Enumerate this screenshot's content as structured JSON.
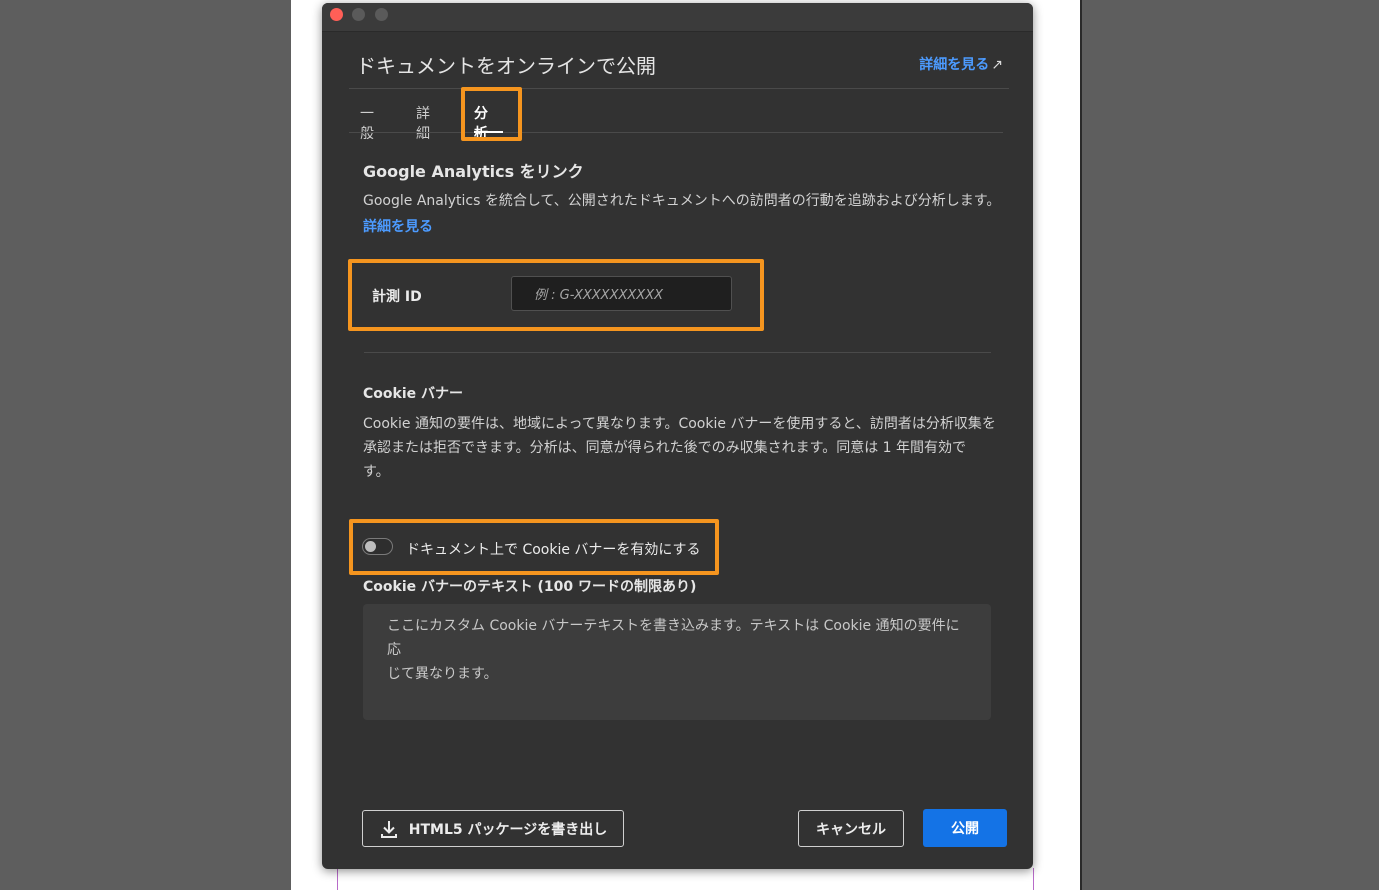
{
  "dialog": {
    "title": "ドキュメントをオンラインで公開",
    "learn_more_top": "詳細を見る",
    "learn_more_arrow": "↗"
  },
  "tabs": [
    {
      "label": "一般"
    },
    {
      "label": "詳細"
    },
    {
      "label": "分析",
      "active": true
    }
  ],
  "analytics": {
    "section_title": "Google Analytics をリンク",
    "description": "Google Analytics を統合して、公開されたドキュメントへの訪問者の行動を追跡および分析します。",
    "learn_more": "詳細を見る",
    "measurement_id_label": "計測 ID",
    "measurement_id_placeholder": "例 : G-XXXXXXXXXX",
    "measurement_id_value": ""
  },
  "cookie": {
    "section_title": "Cookie バナー",
    "description_line1": "Cookie 通知の要件は、地域によって異なります。Cookie バナーを使用すると、訪問者は分析収集を",
    "description_line2": "承認または拒否できます。分析は、同意が得られた後でのみ収集されます。同意は 1 年間有効で",
    "description_line3": "す。",
    "toggle_label": "ドキュメント上で Cookie バナーを有効にする",
    "toggle_on": false,
    "text_label": "Cookie バナーのテキスト (100 ワードの制限あり)",
    "text_placeholder_line1": "ここにカスタム Cookie バナーテキストを書き込みます。テキストは Cookie 通知の要件に応",
    "text_placeholder_line2": "じて異なります。"
  },
  "footer": {
    "export_button": "HTML5 パッケージを書き出し",
    "cancel_button": "キャンセル",
    "publish_button": "公開"
  },
  "colors": {
    "accent_blue": "#1473e6",
    "link_blue": "#4c9bff",
    "highlight_orange": "#f5951f",
    "dialog_bg": "#323232"
  }
}
